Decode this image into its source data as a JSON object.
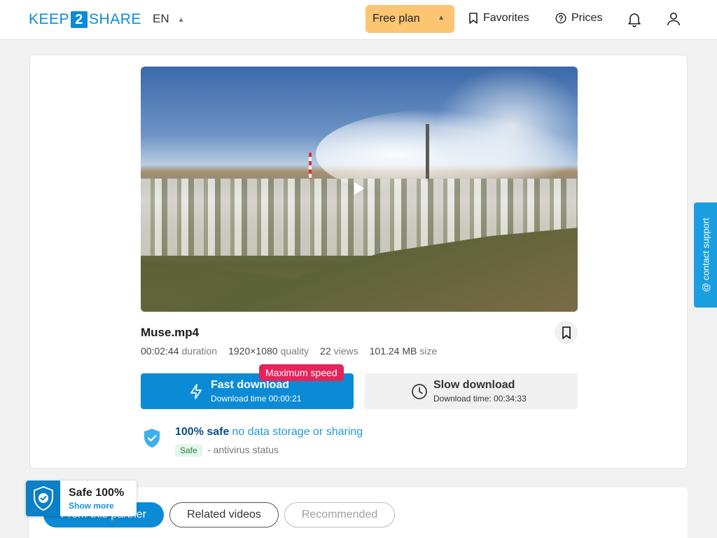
{
  "header": {
    "logo": {
      "pre": "KEEP",
      "mid": "2",
      "post": "SHARE"
    },
    "language": "EN",
    "plan_label": "Free plan",
    "favorites_label": "Favorites",
    "prices_label": "Prices"
  },
  "file": {
    "name": "Muse.mp4",
    "duration_value": "00:02:44",
    "duration_label": "duration",
    "quality_value": "1920×1080",
    "quality_label": "quality",
    "views_value": "22",
    "views_label": "views",
    "size_value": "101.24 MB",
    "size_label": "size"
  },
  "download": {
    "badge": "Maximum speed",
    "fast_title": "Fast download",
    "fast_sub": "Download time 00:00:21",
    "slow_title": "Slow download",
    "slow_sub": "Download time: 00:34:33"
  },
  "safety": {
    "strong": "100% safe",
    "rest": "no data storage or sharing",
    "badge": "Safe",
    "status": "- antivirus status"
  },
  "support": {
    "label": "@ contact support"
  },
  "tabs": [
    {
      "label": "From this partner"
    },
    {
      "label": "Related videos"
    },
    {
      "label": "Recommended"
    }
  ],
  "safe_float": {
    "title": "Safe 100%",
    "link": "Show more"
  },
  "colors": {
    "brand": "#0b8bd6",
    "plan": "#fbc572",
    "badge": "#e5245a",
    "support": "#1a9ee0"
  }
}
